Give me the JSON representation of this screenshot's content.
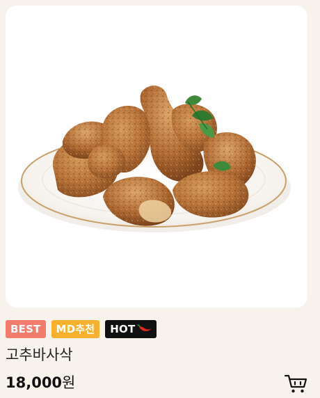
{
  "product": {
    "name": "고추바사삭",
    "price_number": "18,000",
    "price_unit": "원",
    "image_alt": "plate of fried chicken"
  },
  "badges": {
    "best": "BEST",
    "md": "MD추천",
    "hot": "HOT"
  },
  "colors": {
    "page_background": "#f7f2ec",
    "badge_best": "#f47c6c",
    "badge_md": "#f7b12e",
    "badge_hot": "#111111",
    "chili": "#e0281e"
  },
  "icons": {
    "cart": "cart-icon",
    "chili": "chili-pepper-icon"
  }
}
